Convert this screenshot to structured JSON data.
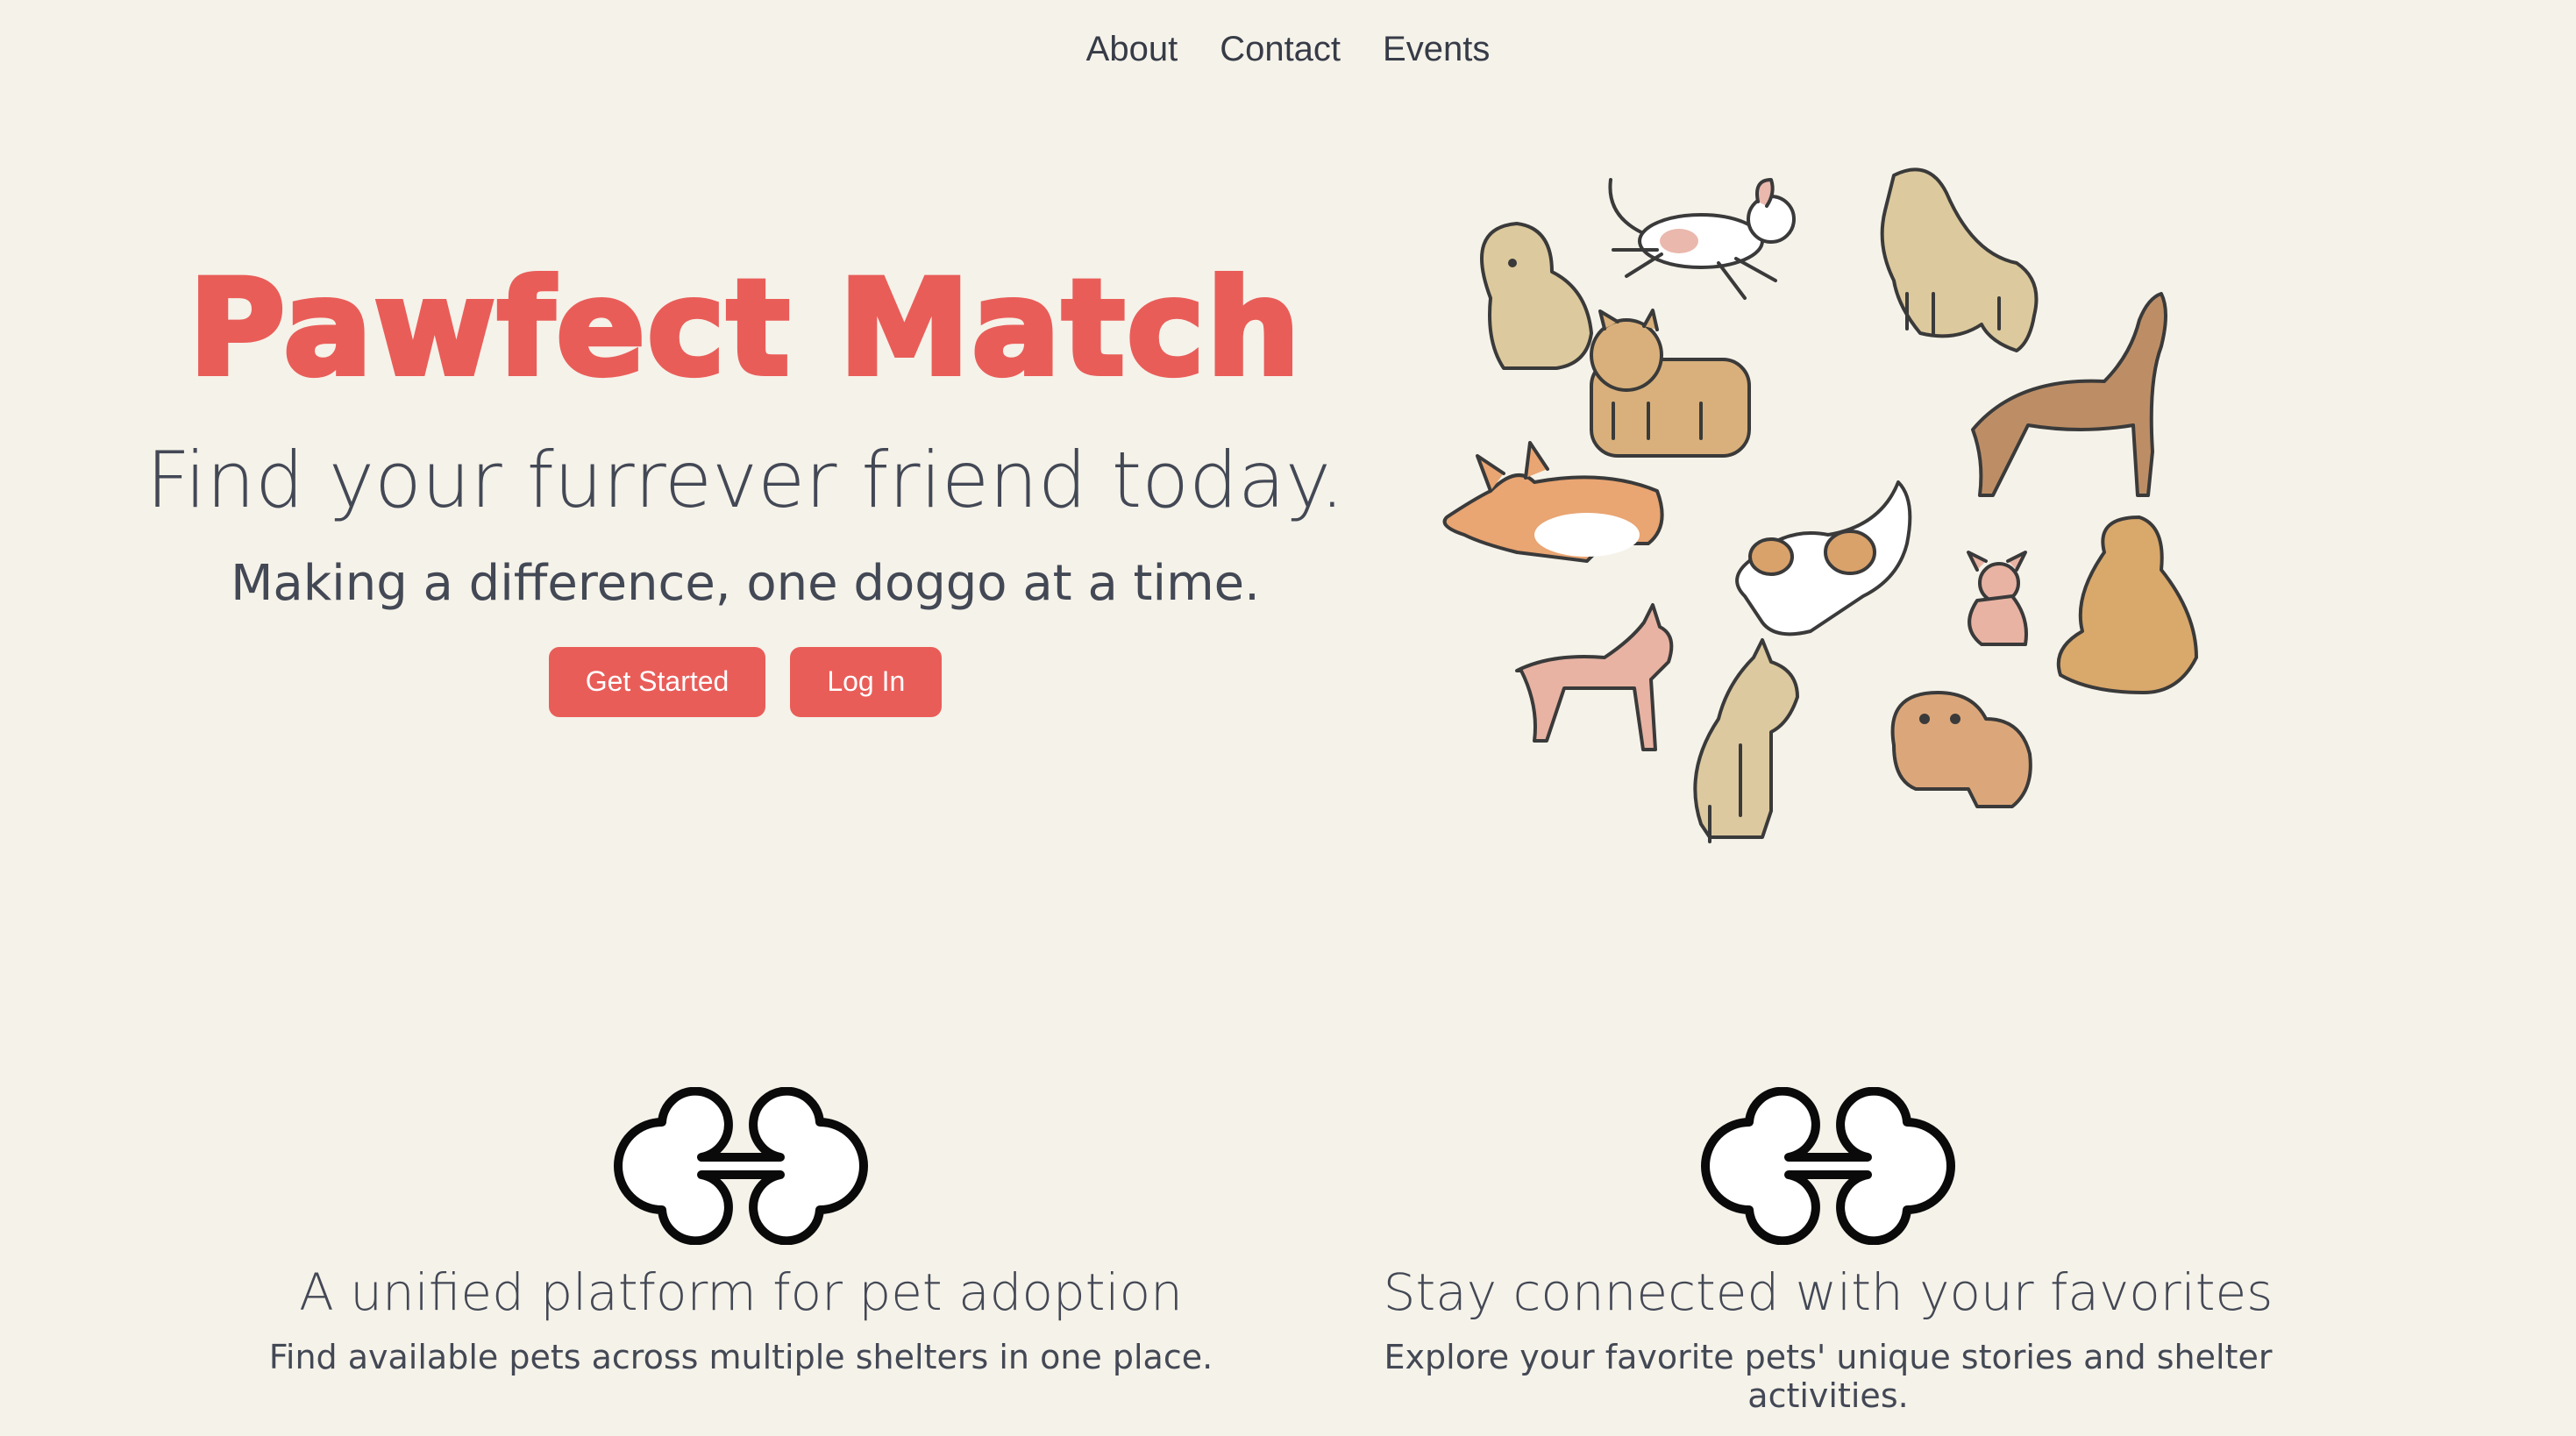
{
  "nav": {
    "items": [
      {
        "label": "About"
      },
      {
        "label": "Contact"
      },
      {
        "label": "Events"
      }
    ]
  },
  "hero": {
    "brand": "Pawfect Match",
    "tagline": "Find your furrever friend today.",
    "subtitle": "Making a difference, one doggo at a time.",
    "get_started_label": "Get Started",
    "login_label": "Log In"
  },
  "features": [
    {
      "icon": "bone-icon",
      "title": "A unified platform for pet adoption",
      "description": "Find available pets across multiple shelters in one place."
    },
    {
      "icon": "bone-icon",
      "title": "Stay connected with your favorites",
      "description": "Explore your favorite pets' unique stories and shelter activities."
    }
  ],
  "colors": {
    "background": "#f5f2e9",
    "accent": "#e95d59",
    "text": "#434855"
  }
}
